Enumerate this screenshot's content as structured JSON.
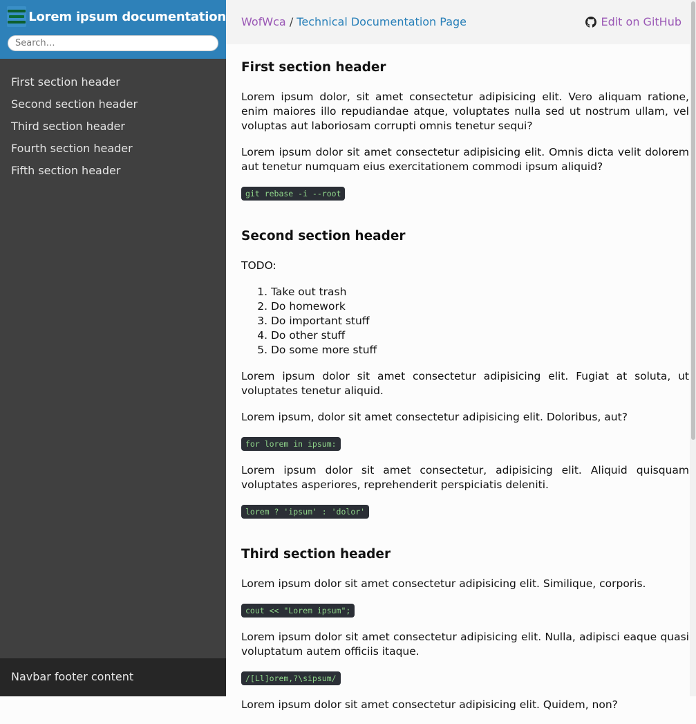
{
  "sidebar": {
    "title": "Lorem ipsum documentation",
    "search_placeholder": "Search…",
    "items": [
      {
        "label": "First section header"
      },
      {
        "label": "Second section header"
      },
      {
        "label": "Third section header"
      },
      {
        "label": "Fourth section header"
      },
      {
        "label": "Fifth section header"
      }
    ],
    "footer": "Navbar footer content"
  },
  "topbar": {
    "breadcrumb_home": "WofWca",
    "breadcrumb_sep": " / ",
    "breadcrumb_current": "Technical Documentation Page",
    "edit_label": "Edit on GitHub",
    "edit_icon": "github-icon"
  },
  "content": {
    "s1": {
      "header": "First section header",
      "p1": "Lorem ipsum dolor, sit amet consectetur adipisicing elit. Vero aliquam ratione, enim maiores illo repudiandae atque, voluptates nulla sed ut nostrum ullam, vel voluptas aut laboriosam corrupti omnis tenetur sequi?",
      "p2": "Lorem ipsum dolor sit amet consectetur adipisicing elit. Omnis dicta velit dolorem aut tenetur numquam eius exercitationem commodi ipsum aliquid?",
      "code1": "git rebase -i --root"
    },
    "s2": {
      "header": "Second section header",
      "todo": "TODO:",
      "list": [
        "Take out trash",
        "Do homework",
        "Do important stuff",
        "Do other stuff",
        "Do some more stuff"
      ],
      "p1": "Lorem ipsum dolor sit amet consectetur adipisicing elit. Fugiat at soluta, ut voluptates tenetur aliquid.",
      "p2": "Lorem ipsum, dolor sit amet consectetur adipisicing elit. Doloribus, aut?",
      "code1": "for lorem in ipsum:",
      "p3": "Lorem ipsum dolor sit amet consectetur, adipisicing elit. Aliquid quisquam voluptates asperiores, reprehenderit perspiciatis deleniti.",
      "code2": "lorem ? 'ipsum' : 'dolor'"
    },
    "s3": {
      "header": "Third section header",
      "p1": "Lorem ipsum dolor sit amet consectetur adipisicing elit. Similique, corporis.",
      "code1": "cout << \"Lorem ipsum\";",
      "p2": "Lorem ipsum dolor sit amet consectetur adipisicing elit. Nulla, adipisci eaque quasi voluptatum autem officiis itaque.",
      "code2": "/[Ll]orem,?\\sipsum/",
      "p3": "Lorem ipsum dolor sit amet consectetur adipisicing elit. Quidem, non?"
    }
  },
  "colors": {
    "sidebar_header": "#2e81b9",
    "sidebar_bg": "#404040",
    "link_purple": "#9b59b6",
    "link_blue": "#2980b9",
    "code_bg": "#2b2f36",
    "code_text": "#8fd58a"
  }
}
